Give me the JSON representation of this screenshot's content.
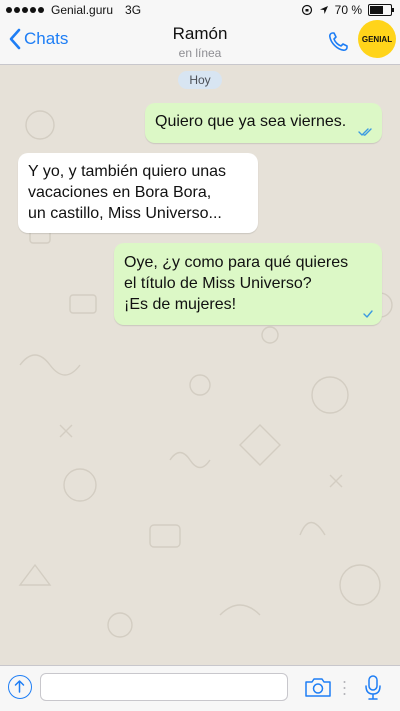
{
  "status_bar": {
    "carrier": "Genial.guru",
    "network": "3G",
    "battery_text": "70 %",
    "battery_level": 0.7
  },
  "header": {
    "back_label": "Chats",
    "contact_name": "Ramón",
    "status": "en línea",
    "badge": "GENIAL",
    "icons": [
      "chevron-left-icon",
      "phone-icon"
    ]
  },
  "chat": {
    "date_label": "Hoy",
    "messages": [
      {
        "direction": "out",
        "lines": [
          "Quiero que ya sea viernes."
        ],
        "ticks": "double-blue"
      },
      {
        "direction": "in",
        "lines": [
          "Y yo, y también quiero unas",
          "vacaciones en Bora Bora,",
          "un castillo, Miss Universo..."
        ]
      },
      {
        "direction": "out",
        "lines": [
          "Oye, ¿y como para qué quieres",
          "el título de Miss Universo?",
          "¡Es de mujeres!"
        ],
        "ticks": "single-blue"
      }
    ]
  },
  "input_bar": {
    "placeholder": "",
    "icons": [
      "share-icon",
      "camera-icon",
      "microphone-icon"
    ]
  },
  "colors": {
    "accent": "#1e7ef5",
    "outgoing_bubble": "#dcf8c6",
    "incoming_bubble": "#ffffff",
    "wallpaper": "#e6e1d8",
    "badge_yellow": "#ffd41a"
  }
}
